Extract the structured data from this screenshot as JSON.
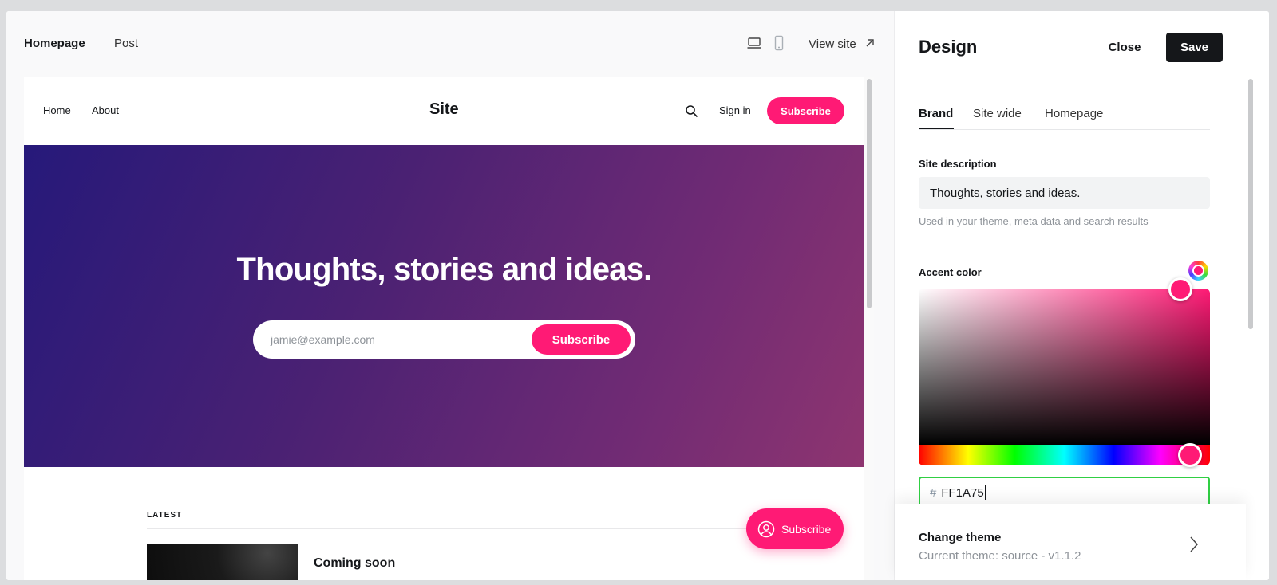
{
  "editor": {
    "tabs": [
      {
        "label": "Homepage",
        "active": true
      },
      {
        "label": "Post",
        "active": false
      }
    ],
    "view_site_label": "View site",
    "device_icons": [
      "desktop-icon",
      "mobile-icon"
    ]
  },
  "preview": {
    "nav": {
      "links": [
        "Home",
        "About"
      ],
      "site_title": "Site",
      "signin": "Sign in",
      "subscribe": "Subscribe"
    },
    "hero": {
      "title": "Thoughts, stories and ideas.",
      "email_placeholder": "jamie@example.com",
      "subscribe": "Subscribe",
      "gradient_start": "#26197a",
      "gradient_end": "#8e3570"
    },
    "latest_label": "LATEST",
    "post_title": "Coming soon",
    "floating_subscribe": "Subscribe"
  },
  "design_panel": {
    "title": "Design",
    "close": "Close",
    "save": "Save",
    "tabs": [
      {
        "label": "Brand",
        "active": true
      },
      {
        "label": "Site wide",
        "active": false
      },
      {
        "label": "Homepage",
        "active": false
      }
    ],
    "site_description": {
      "label": "Site description",
      "value": "Thoughts, stories and ideas.",
      "hint": "Used in your theme, meta data and search results"
    },
    "accent_color": {
      "label": "Accent color",
      "hash": "#",
      "hex": "FF1A75",
      "color": "#ff1a75"
    },
    "change_theme": {
      "title": "Change theme",
      "current": "Current theme: source - v1.1.2"
    }
  },
  "colors": {
    "accent": "#ff1a75",
    "dark": "#15171a",
    "focus_border": "#30cf43"
  }
}
